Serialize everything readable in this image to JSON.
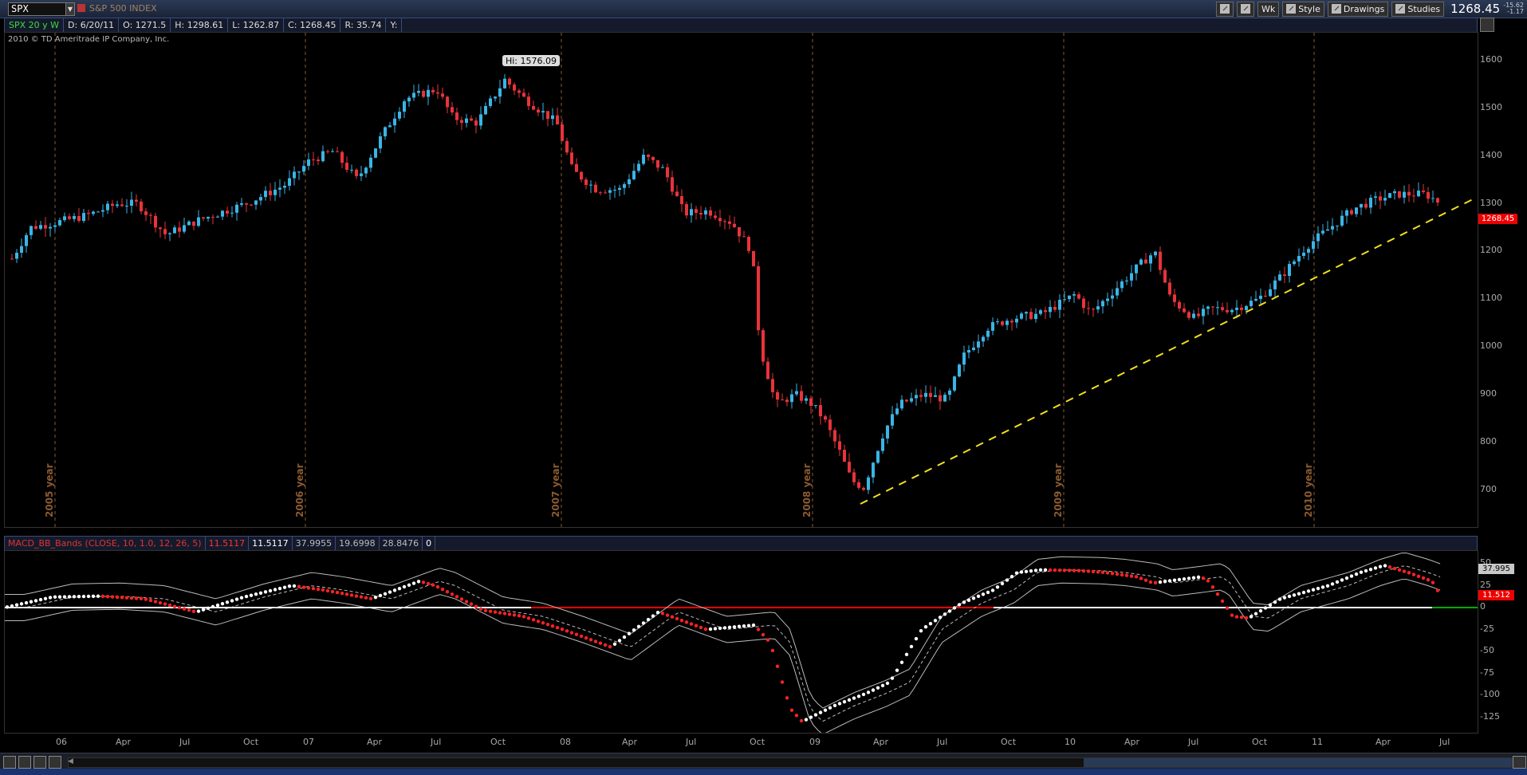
{
  "toolbar": {
    "symbol": "SPX",
    "description": "S&P 500 INDEX",
    "wk_label": "Wk",
    "style_label": "Style",
    "drawings_label": "Drawings",
    "studies_label": "Studies",
    "last_price": "1268.45",
    "change": "-15.62",
    "change_pct": "-1.17"
  },
  "infobar": {
    "symbol_period": "SPX 20 y W",
    "date": "D: 6/20/11",
    "open": "O: 1271.5",
    "high": "H: 1298.61",
    "low": "L: 1262.87",
    "close": "C: 1268.45",
    "range": "R: 35.74",
    "y": "Y:"
  },
  "copyright": "2010 © TD Ameritrade IP Company, Inc.",
  "price_panel": {
    "hi_label": "Hi: 1576.09",
    "price_tag": "1268.45",
    "y_labels": [
      "1600",
      "1500",
      "1400",
      "1300",
      "1200",
      "1100",
      "1000",
      "900",
      "800",
      "700"
    ],
    "year_labels": [
      "2005 year",
      "2006 year",
      "2007 year",
      "2008 year",
      "2009 year",
      "2010 year"
    ]
  },
  "macd_bar": {
    "name": "MACD_BB_Bands (CLOSE, 10, 1.0, 12, 26, 5)",
    "v1": "11.5117",
    "v2": "11.5117",
    "v3": "37.9955",
    "v4": "19.6998",
    "v5": "28.8476",
    "v6": "0"
  },
  "macd_panel": {
    "y_labels": [
      "50",
      "25",
      "0",
      "-25",
      "-50",
      "-75",
      "-100",
      "-125"
    ],
    "upper_tag": "37.995",
    "value_tag": "11.512"
  },
  "x_axis": [
    "06",
    "Apr",
    "Jul",
    "Oct",
    "07",
    "Apr",
    "Jul",
    "Oct",
    "08",
    "Apr",
    "Jul",
    "Oct",
    "09",
    "Apr",
    "Jul",
    "Oct",
    "10",
    "Apr",
    "Jul",
    "Oct",
    "11",
    "Apr",
    "Jul"
  ],
  "colors": {
    "up_candle": "#3ab5e6",
    "down_candle": "#e8333b",
    "trendline": "#f0e020",
    "year_line": "#8a5a30"
  }
}
